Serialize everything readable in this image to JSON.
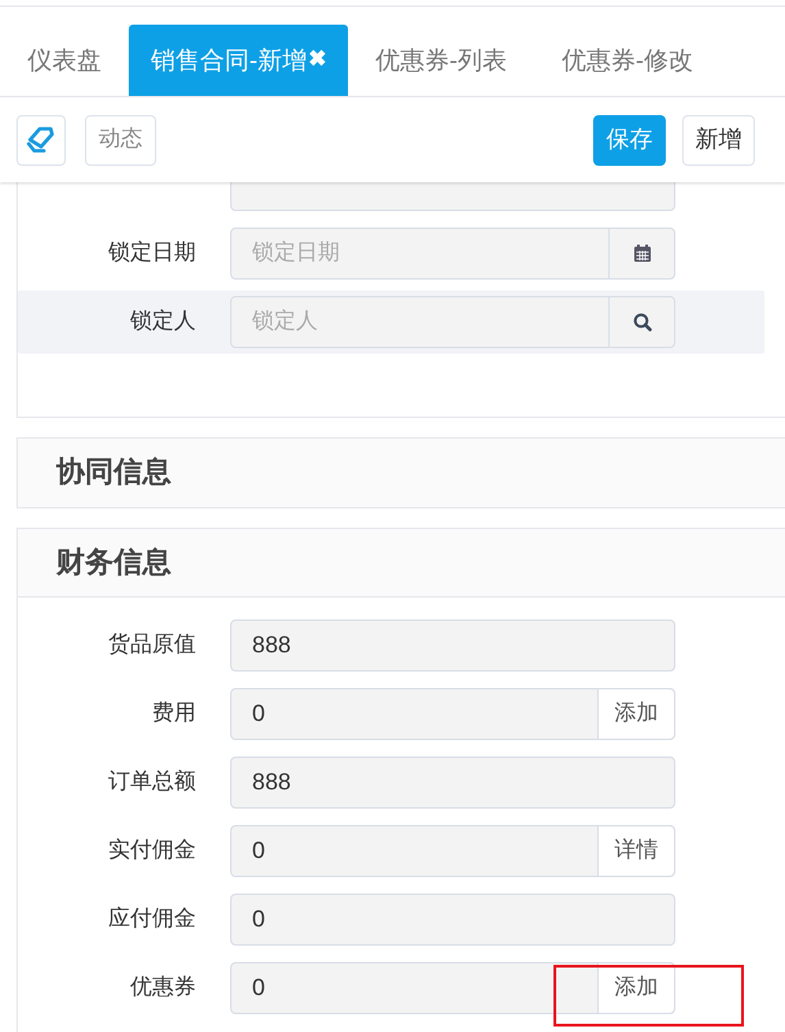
{
  "tabs": [
    {
      "label": "仪表盘",
      "selected": false
    },
    {
      "label": "销售合同-新增",
      "selected": true,
      "close": "✖"
    },
    {
      "label": "优惠券-列表",
      "selected": false
    },
    {
      "label": "优惠券-修改",
      "selected": false
    }
  ],
  "toolbar": {
    "left": [
      {
        "kind": "icon"
      },
      {
        "kind": "text",
        "label": "动态"
      }
    ],
    "right": [
      {
        "label": "保存",
        "primary": true
      },
      {
        "label": "新增",
        "primary": false
      }
    ]
  },
  "lock_section": {
    "fields": [
      {
        "kind": "date",
        "label": "锁定日期",
        "placeholder": "锁定日期",
        "hover": false
      },
      {
        "kind": "lookup",
        "label": "锁定人",
        "placeholder": "锁定人",
        "hover": true
      }
    ]
  },
  "sections": [
    {
      "title": "协同信息",
      "expanded": false
    },
    {
      "title": "财务信息",
      "expanded": true
    }
  ],
  "finance_fields": [
    {
      "label": "货品原值",
      "value": "888",
      "highlighted": false
    },
    {
      "label": "费用",
      "value": "0",
      "addon": "添加",
      "highlighted": false
    },
    {
      "label": "订单总额",
      "value": "888",
      "highlighted": false
    },
    {
      "label": "实付佣金",
      "value": "0",
      "addon": "详情",
      "highlighted": false
    },
    {
      "label": "应付佣金",
      "value": "0",
      "highlighted": false
    },
    {
      "label": "优惠券",
      "value": "0",
      "addon": "添加",
      "highlighted": true
    }
  ]
}
